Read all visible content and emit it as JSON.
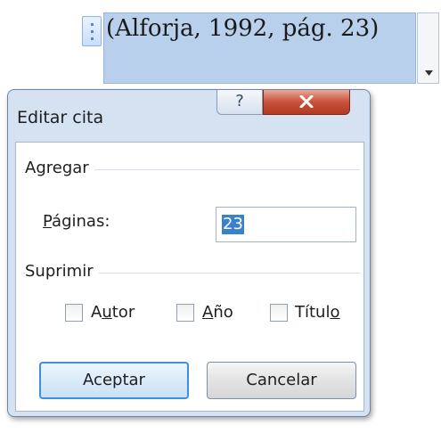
{
  "citation": {
    "text": "(Alforja, 1992, pág. 23)"
  },
  "dialog": {
    "title": "Editar cita",
    "help_glyph": "?",
    "add_group": {
      "label": "Agregar",
      "pages_label_prefix": "",
      "pages_label_underlined": "P",
      "pages_label_rest": "áginas:",
      "pages_value": "23"
    },
    "suppress_group": {
      "label": "Suprimir",
      "checkboxes": [
        {
          "label_pre": "A",
          "label_u": "u",
          "label_post": "tor",
          "checked": false
        },
        {
          "label_pre": "",
          "label_u": "A",
          "label_post": "ño",
          "checked": false
        },
        {
          "label_pre": "Títul",
          "label_u": "o",
          "label_post": "",
          "checked": false
        }
      ]
    },
    "buttons": {
      "ok": "Aceptar",
      "cancel": "Cancelar"
    }
  },
  "colors": {
    "citation_highlight": "#b8d0ec",
    "dialog_frame": "#d4e2f2",
    "close_button": "#c7513b",
    "selection": "#3b80ce"
  }
}
